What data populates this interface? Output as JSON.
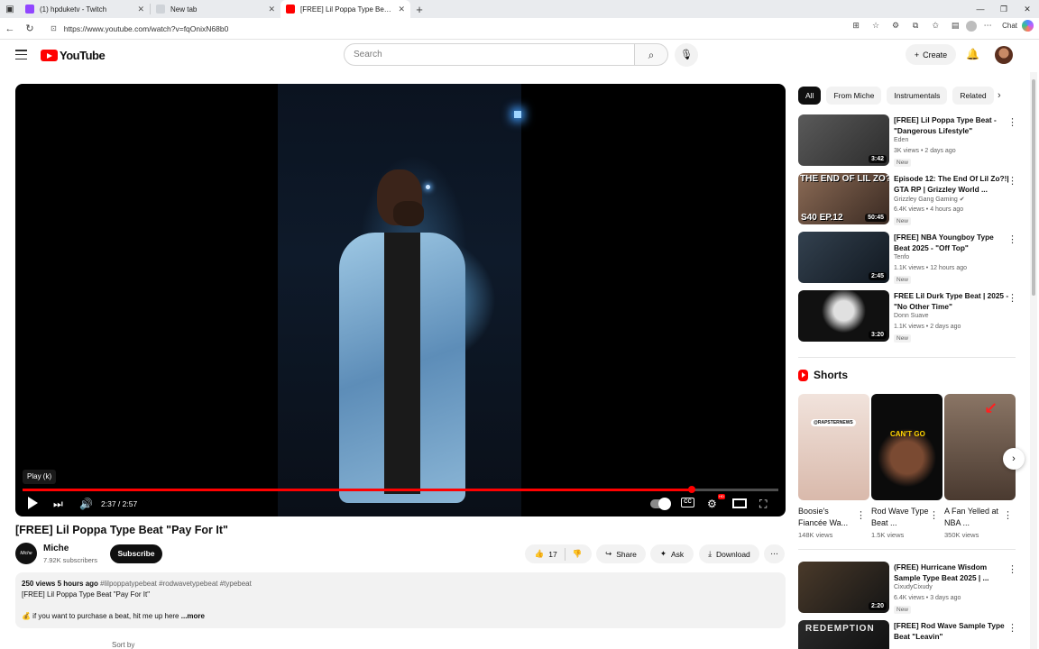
{
  "browser": {
    "tabs": [
      {
        "title": "(1) hpduketv - Twitch",
        "color": "#9146ff"
      },
      {
        "title": "New tab",
        "color": "#cfd3d8"
      },
      {
        "title": "[FREE] Lil Poppa Type Beat \"Pay F",
        "color": "#ff0000"
      }
    ],
    "url": "https://www.youtube.com/watch?v=fqOnixN68b0",
    "chat_label": "Chat"
  },
  "header": {
    "logo_text": "YouTube",
    "search_placeholder": "Search",
    "create_label": "Create"
  },
  "player": {
    "tooltip": "Play (k)",
    "time": "2:37 / 2:57",
    "progress_fraction": 0.885,
    "hd_badge": "HD"
  },
  "video": {
    "title": "[FREE] Lil Poppa Type Beat \"Pay For It\"",
    "channel": "Miche",
    "channel_avatar_text": "Miche",
    "subscribers": "7.92K subscribers",
    "subscribe_label": "Subscribe",
    "likes": "17",
    "share_label": "Share",
    "ask_label": "Ask",
    "download_label": "Download",
    "description": {
      "stats": "250 views  5 hours ago",
      "tags": "#lilpoppatypebeat #rodwavetypebeat #typebeat",
      "line1": "[FREE] Lil Poppa Type Beat \"Pay For It\"",
      "line2": "💰 if you want to purchase a beat, hit me up here",
      "more": "...more"
    },
    "sort_label": "Sort by"
  },
  "filters": [
    "All",
    "From Miche",
    "Instrumentals",
    "Related"
  ],
  "recommendations": [
    {
      "title": "[FREE] Lil Poppa Type Beat - \"Dangerous Lifestyle\"",
      "channel": "Eden",
      "meta": "3K views • 2 days ago",
      "badge": "New",
      "duration": "3:42",
      "thumb": "#3a3a3a"
    },
    {
      "title": "Episode 12: The End Of Lil Zo?!| GTA RP | Grizzley World ...",
      "channel": "Grizzley Gang Gaming ✔",
      "meta": "6.4K views • 4 hours ago",
      "badge": "New",
      "duration": "50:45",
      "thumb": "#6b4a3a",
      "overlay_top": "THE END OF LIL ZO?!",
      "overlay_bottom": "S40 EP.12"
    },
    {
      "title": "[FREE] NBA Youngboy Type Beat 2025 - \"Off Top\"",
      "channel": "Tenfo",
      "meta": "1.1K views • 12 hours ago",
      "badge": "New",
      "duration": "2:45",
      "thumb": "#222a33"
    },
    {
      "title": "FREE Lil Durk Type Beat | 2025 - \"No Other Time\"",
      "channel": "Donn Suave",
      "meta": "1.1K views • 2 days ago",
      "badge": "New",
      "duration": "3:20",
      "thumb": "#111111"
    },
    {
      "title": "(FREE) Hurricane Wisdom Sample Type Beat 2025 | ...",
      "channel": "CixudyCixudy",
      "meta": "6.4K views • 3 days ago",
      "badge": "New",
      "duration": "2:20",
      "thumb": "#2b2b2b"
    },
    {
      "title": "[FREE] Rod Wave Sample Type Beat \"Leavin\"",
      "channel": "",
      "meta": "",
      "badge": "",
      "duration": "",
      "thumb": "#1d1d1d",
      "overlay_top": "REDEMPTION"
    }
  ],
  "shorts": {
    "title": "Shorts",
    "items": [
      {
        "title": "Boosie's Fiancée Wa...",
        "views": "148K views",
        "thumb": "#e8d6cf",
        "overlay": "@RAPSTERNEWS"
      },
      {
        "title": "Rod Wave Type Beat ...",
        "views": "1.5K views",
        "thumb": "#0b0b0b",
        "overlay": "CAN'T GO"
      },
      {
        "title": "A Fan Yelled at NBA ...",
        "views": "350K views",
        "thumb": "#6a5a4a",
        "overlay": ""
      }
    ]
  }
}
